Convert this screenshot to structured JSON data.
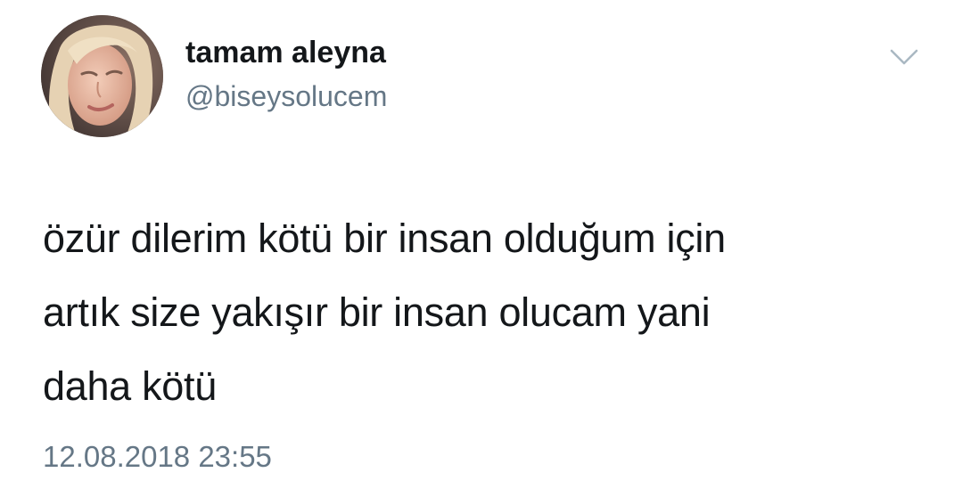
{
  "tweet": {
    "display_name": "tamam aleyna",
    "handle": "@biseysolucem",
    "text_lines": [
      "özür dilerim kötü bir insan olduğum için",
      "artık size yakışır bir insan olucam yani",
      "daha kötü"
    ],
    "timestamp": "12.08.2018 23:55",
    "menu_icon": "chevron-down-icon",
    "colors": {
      "text": "#14171a",
      "secondary": "#657786",
      "caret": "#aab8c2",
      "background": "#ffffff"
    }
  }
}
